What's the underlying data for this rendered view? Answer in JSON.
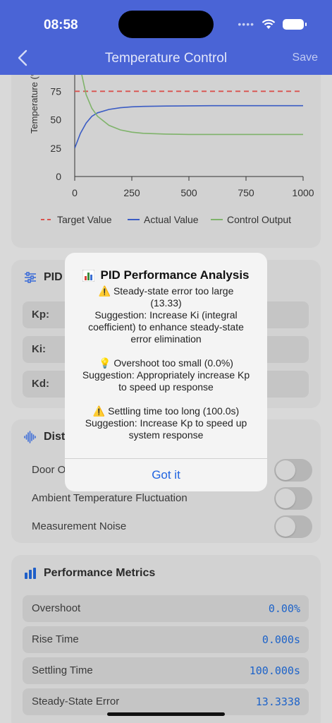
{
  "status_bar": {
    "time": "08:58"
  },
  "nav": {
    "title": "Temperature Control",
    "save_label": "Save"
  },
  "chart_data": {
    "type": "line",
    "ylabel": "Temperature (°",
    "xlim": [
      0,
      1000
    ],
    "ylim": [
      0,
      100
    ],
    "x_ticks": [
      "0",
      "250",
      "500",
      "750",
      "1000"
    ],
    "y_ticks": [
      "0",
      "25",
      "50",
      "75"
    ],
    "legend_position": "bottom",
    "series": [
      {
        "name": "Target Value",
        "color": "#d9534f",
        "style": "dashed",
        "x": [
          0,
          1000
        ],
        "y": [
          75,
          75
        ]
      },
      {
        "name": "Actual Value",
        "color": "#3b5cc4",
        "style": "solid",
        "x": [
          0,
          25,
          50,
          75,
          100,
          150,
          200,
          250,
          300,
          400,
          500,
          600,
          700,
          800,
          1000
        ],
        "y": [
          25,
          38,
          47,
          53,
          56,
          59,
          60.5,
          61.3,
          61.7,
          62,
          62.2,
          62.3,
          62.3,
          62.3,
          62.3
        ]
      },
      {
        "name": "Control Output",
        "color": "#7fb36a",
        "style": "solid",
        "x": [
          0,
          25,
          50,
          75,
          100,
          150,
          200,
          250,
          300,
          400,
          500,
          600,
          700,
          800,
          1000
        ],
        "y": [
          130,
          95,
          72,
          60,
          53,
          45,
          41,
          39,
          38,
          37.3,
          37,
          37,
          37,
          37,
          37
        ]
      }
    ]
  },
  "pid": {
    "title": "PID",
    "rows": [
      {
        "label": "Kp:"
      },
      {
        "label": "Ki:"
      },
      {
        "label": "Kd:"
      }
    ]
  },
  "disturbance": {
    "title": "Dist",
    "toggles": [
      {
        "label": "Door O",
        "on": false
      },
      {
        "label": "Ambient Temperature Fluctuation",
        "on": false
      },
      {
        "label": "Measurement Noise",
        "on": false
      }
    ]
  },
  "metrics": {
    "title": "Performance Metrics",
    "rows": [
      {
        "label": "Overshoot",
        "value": "0.00%"
      },
      {
        "label": "Rise Time",
        "value": "0.000s"
      },
      {
        "label": "Settling Time",
        "value": "100.000s"
      },
      {
        "label": "Steady-State Error",
        "value": "13.3338"
      }
    ]
  },
  "alert": {
    "title": "PID Performance Analysis",
    "lines": [
      "⚠️ Steady-state error too large",
      "(13.33)",
      "Suggestion: Increase Ki (integral",
      "coefficient) to enhance steady-state",
      "error elimination",
      "",
      "💡 Overshoot too small (0.0%)",
      "Suggestion: Appropriately increase Kp",
      "to speed up response",
      "",
      "⚠️ Settling time too long (100.0s)",
      "Suggestion: Increase Kp to speed up",
      "system response"
    ],
    "button_label": "Got it"
  },
  "colors": {
    "header": "#4a64d6",
    "accent": "#1f63e0",
    "value": "#1d63c9"
  }
}
